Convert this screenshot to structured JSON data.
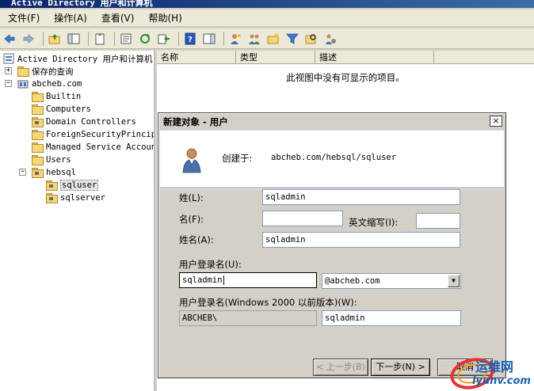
{
  "window": {
    "title": "Active Directory 用户和计算机"
  },
  "menu": [
    {
      "label": "文件(F)"
    },
    {
      "label": "操作(A)"
    },
    {
      "label": "查看(V)"
    },
    {
      "label": "帮助(H)"
    }
  ],
  "tree": {
    "root": "Active Directory 用户和计算机",
    "saved_queries": "保存的查询",
    "domain": "abcheb.com",
    "items": [
      "Builtin",
      "Computers",
      "Domain Controllers",
      "ForeignSecurityPrincipals",
      "Managed Service Accounts",
      "Users"
    ],
    "ou": "hebsql",
    "ou_children": [
      "sqluser",
      "sqlserver"
    ]
  },
  "list": {
    "columns": [
      "名称",
      "类型",
      "描述"
    ],
    "empty_message": "此视图中没有可显示的项目。"
  },
  "dialog": {
    "title": "新建对象 - 用户",
    "close_glyph": "×",
    "created_in_label": "创建于:",
    "created_in_value": "abcheb.com/hebsql/sqluser",
    "last_name_label": "姓(L):",
    "last_name_value": "sqladmin",
    "first_name_label": "名(F):",
    "first_name_value": "",
    "initials_label": "英文缩写(I):",
    "initials_value": "",
    "full_name_label": "姓名(A):",
    "full_name_value": "sqladmin",
    "logon_label": "用户登录名(U):",
    "logon_value": "sqladmin",
    "upn_suffix": "@abcheb.com",
    "pre2000_label": "用户登录名(Windows 2000 以前版本)(W):",
    "pre2000_domain": "ABCHEB\\",
    "pre2000_value": "sqladmin",
    "back_button": "< 上一步(B)",
    "next_button": "下一步(N) >",
    "cancel_button": "取消"
  },
  "watermark": {
    "name": "运维网",
    "domain": "iyunv.com"
  }
}
